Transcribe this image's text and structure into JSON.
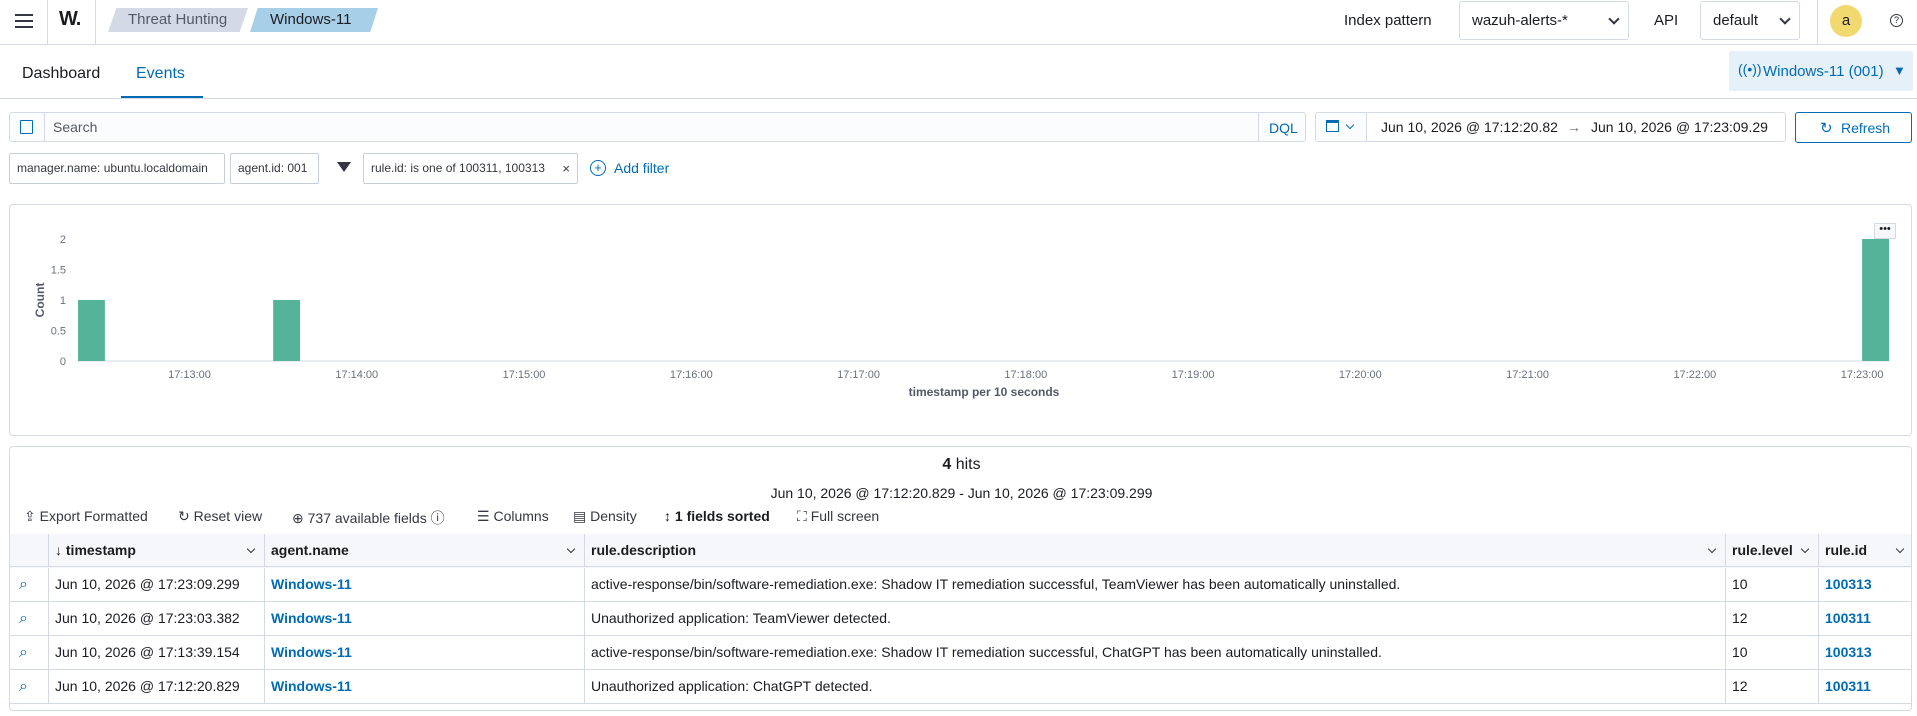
{
  "header": {
    "logo": "W.",
    "breadcrumbs": [
      "Threat Hunting",
      "Windows-11"
    ],
    "index_pattern_label": "Index pattern",
    "index_pattern_value": "wazuh-alerts-*",
    "api_label": "API",
    "api_value": "default",
    "avatar_initial": "a",
    "icons": [
      "menu-icon",
      "help-icon"
    ]
  },
  "tabs": [
    "Dashboard",
    "Events"
  ],
  "active_tab": "Events",
  "agent_badge": "Windows-11 (001)",
  "search": {
    "placeholder": "Search",
    "language": "DQL",
    "time_from": "Jun 10, 2026 @ 17:12:20.82",
    "arrow": "→",
    "time_to": "Jun 10, 2026 @ 17:23:09.29",
    "refresh_label": "Refresh"
  },
  "filters": [
    "manager.name: ubuntu.localdomain",
    "agent.id: 001",
    "rule.id: is one of 100311, 100313"
  ],
  "add_filter_label": "Add filter",
  "chart_data": {
    "type": "bar",
    "ylabel": "Count",
    "xlabel": "timestamp per 10 seconds",
    "yticks": [
      "2",
      "1.5",
      "1",
      "0.5",
      "0"
    ],
    "ylim": [
      0,
      2
    ],
    "xticks": [
      "17:13:00",
      "17:14:00",
      "17:15:00",
      "17:16:00",
      "17:17:00",
      "17:18:00",
      "17:19:00",
      "17:20:00",
      "17:21:00",
      "17:22:00",
      "17:23:00"
    ],
    "xlim": [
      "17:12:20",
      "17:23:10"
    ],
    "bars": [
      {
        "x": "17:12:20",
        "value": 1
      },
      {
        "x": "17:13:30",
        "value": 1
      },
      {
        "x": "17:23:00",
        "value": 2
      }
    ],
    "color": "#54b399"
  },
  "results": {
    "hits_count": "4",
    "hits_label": "hits",
    "range": "Jun 10, 2026 @ 17:12:20.829 - Jun 10, 2026 @ 17:23:09.299",
    "toolbar": {
      "export": "Export Formatted",
      "reset": "Reset view",
      "fields": "737 available fields",
      "columns": "Columns",
      "density": "Density",
      "sorted": "1 fields sorted",
      "fullscreen": "Full screen"
    },
    "columns": [
      "timestamp",
      "agent.name",
      "rule.description",
      "rule.level",
      "rule.id"
    ],
    "rows": [
      {
        "timestamp": "Jun 10, 2026 @ 17:23:09.299",
        "agent": "Windows-11",
        "description": "active-response/bin/software-remediation.exe: Shadow IT remediation successful, TeamViewer has been automatically uninstalled.",
        "level": "10",
        "rule_id": "100313"
      },
      {
        "timestamp": "Jun 10, 2026 @ 17:23:03.382",
        "agent": "Windows-11",
        "description": "Unauthorized application: TeamViewer detected.",
        "level": "12",
        "rule_id": "100311"
      },
      {
        "timestamp": "Jun 10, 2026 @ 17:13:39.154",
        "agent": "Windows-11",
        "description": "active-response/bin/software-remediation.exe: Shadow IT remediation successful, ChatGPT has been automatically uninstalled.",
        "level": "10",
        "rule_id": "100313"
      },
      {
        "timestamp": "Jun 10, 2026 @ 17:12:20.829",
        "agent": "Windows-11",
        "description": "Unauthorized application: ChatGPT detected.",
        "level": "12",
        "rule_id": "100311"
      }
    ]
  },
  "colors": {
    "accent": "#006bb4",
    "bar": "#54b399",
    "avatar": "#f1d86f",
    "active_crumb": "#a8cfe8",
    "crumb": "#d3dae6"
  }
}
